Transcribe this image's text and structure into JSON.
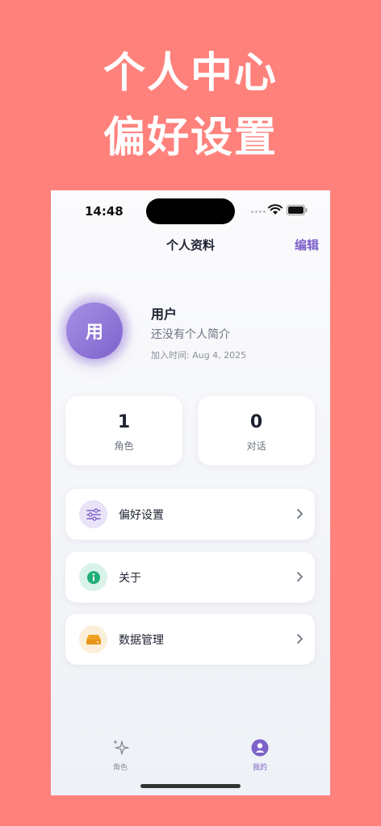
{
  "headline": {
    "line1": "个人中心",
    "line2": "偏好设置"
  },
  "status_bar": {
    "time": "14:48"
  },
  "nav": {
    "title": "个人资料",
    "edit": "编辑"
  },
  "profile": {
    "avatar_text": "用",
    "name": "用户",
    "bio": "还没有个人简介",
    "joined": "加入时间: Aug 4, 2025"
  },
  "stats": [
    {
      "value": "1",
      "label": "角色"
    },
    {
      "value": "0",
      "label": "对话"
    }
  ],
  "menu": [
    {
      "label": "偏好设置",
      "icon": "sliders-icon"
    },
    {
      "label": "关于",
      "icon": "info-icon"
    },
    {
      "label": "数据管理",
      "icon": "storage-icon"
    }
  ],
  "tabs": [
    {
      "label": "角色",
      "icon": "sparkle-icon",
      "active": false
    },
    {
      "label": "我的",
      "icon": "person-icon",
      "active": true
    }
  ],
  "colors": {
    "background": "#FF817C",
    "accent": "#7D62C8",
    "text": "#1E2230"
  }
}
